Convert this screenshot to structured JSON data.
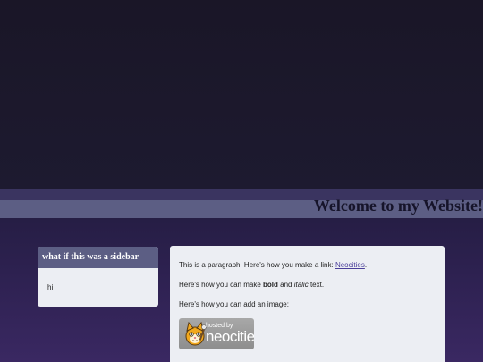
{
  "header": {
    "title": "Welcome to my Website!"
  },
  "sidebar": {
    "title": "what if this was a sidebar",
    "body": "hi"
  },
  "main": {
    "para1_text": "This is a paragraph! Here's how you make a link: ",
    "para1_link": "Neocities",
    "para1_end": ".",
    "para2_start": "Here's how you can make ",
    "para2_bold": "bold",
    "para2_mid": " and ",
    "para2_italic": "italic",
    "para2_end": " text.",
    "para3_text": "Here's how you can add an image:",
    "badge": {
      "small_text": "hosted by",
      "big_text": "neocities",
      "icon": "neocities-cat-icon"
    }
  },
  "colors": {
    "background_dark": "#1b1729",
    "background_purple": "#3a2862",
    "header_bar": "#5c5e84",
    "panel": "#eceef3",
    "link": "#4a3e9a"
  }
}
